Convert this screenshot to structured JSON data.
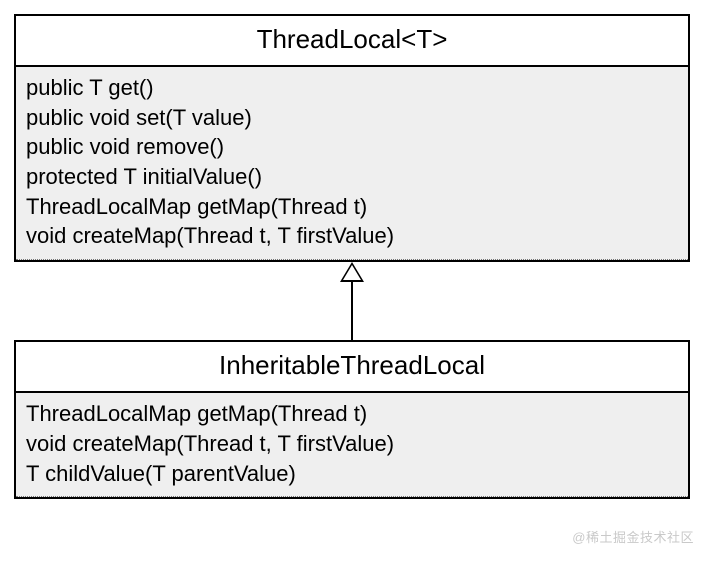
{
  "parent": {
    "name": "ThreadLocal<T>",
    "methods": [
      "public T get()",
      "public void set(T value)",
      "public void remove()",
      "protected T initialValue()",
      "ThreadLocalMap getMap(Thread t)",
      "void createMap(Thread t, T firstValue)"
    ]
  },
  "child": {
    "name": "InheritableThreadLocal",
    "methods": [
      "ThreadLocalMap getMap(Thread t)",
      "void createMap(Thread t, T firstValue)",
      "T childValue(T parentValue)"
    ]
  },
  "watermark": "@稀土掘金技术社区"
}
